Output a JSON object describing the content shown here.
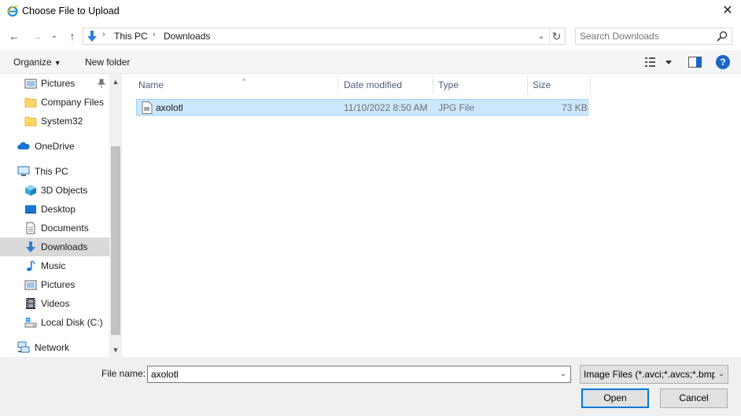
{
  "window": {
    "title": "Choose File to Upload",
    "close_glyph": "✕"
  },
  "nav_buttons": {
    "back": "←",
    "forward": "→",
    "recent": "⌄",
    "up": "↑"
  },
  "address": {
    "crumbs": [
      "This PC",
      "Downloads"
    ],
    "separator": "›",
    "dropdown_glyph": "⌄",
    "refresh_glyph": "↻"
  },
  "search": {
    "placeholder": "Search Downloads"
  },
  "toolbar": {
    "organize_label": "Organize",
    "new_folder_label": "New folder",
    "help_label": "?"
  },
  "sidebar": {
    "items": [
      {
        "label": "Pictures",
        "icon": "pictures-icon"
      },
      {
        "label": "Company Files",
        "icon": "folder-icon"
      },
      {
        "label": "System32",
        "icon": "folder-icon"
      },
      {
        "label": "OneDrive",
        "icon": "cloud-icon"
      },
      {
        "label": "This PC",
        "icon": "computer-icon"
      },
      {
        "label": "3D Objects",
        "icon": "cube-icon"
      },
      {
        "label": "Desktop",
        "icon": "desktop-icon"
      },
      {
        "label": "Documents",
        "icon": "document-icon"
      },
      {
        "label": "Downloads",
        "icon": "download-arrow-icon"
      },
      {
        "label": "Music",
        "icon": "music-note-icon"
      },
      {
        "label": "Pictures",
        "icon": "pictures-icon"
      },
      {
        "label": "Videos",
        "icon": "film-icon"
      },
      {
        "label": "Local Disk (C:)",
        "icon": "drive-icon"
      },
      {
        "label": "Network",
        "icon": "network-icon"
      }
    ],
    "selected": "Downloads"
  },
  "columns": {
    "name": "Name",
    "date": "Date modified",
    "type": "Type",
    "size": "Size"
  },
  "files": [
    {
      "name": "axolotl",
      "date": "11/10/2022 8:50 AM",
      "type": "JPG File",
      "size": "73 KB"
    }
  ],
  "footer": {
    "file_name_label": "File name:",
    "file_name_value": "axolotl",
    "file_type_value": "Image Files (*.avci;*.avcs;*.bmp",
    "open_label": "Open",
    "cancel_label": "Cancel"
  },
  "colors": {
    "selection_bg": "#cce8ff",
    "selection_border": "#99d1ff",
    "accent": "#0078d7",
    "help_blue": "#1a66c9"
  }
}
